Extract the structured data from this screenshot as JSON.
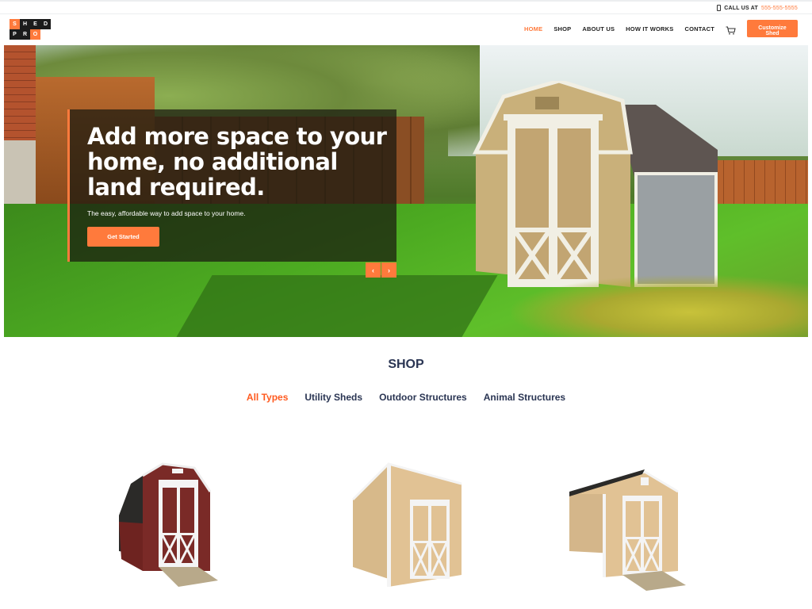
{
  "topbar": {
    "phone_icon": "phone-icon",
    "call_label": "CALL US AT",
    "phone_number": "555-555-5555"
  },
  "header": {
    "logo_letters": [
      "S",
      "H",
      "E",
      "D",
      "P",
      "R",
      "O"
    ],
    "nav": [
      {
        "label": "HOME",
        "active": true
      },
      {
        "label": "SHOP",
        "active": false
      },
      {
        "label": "ABOUT US",
        "active": false
      },
      {
        "label": "HOW IT WORKS",
        "active": false
      },
      {
        "label": "CONTACT",
        "active": false
      }
    ],
    "cart_icon": "cart-icon",
    "cta_label": "Customize Shed"
  },
  "hero": {
    "headline": "Add more space to your home, no additional land required.",
    "subtext": "The easy, affordable way to add space to your home.",
    "button_label": "Get Started",
    "prev_label": "‹",
    "next_label": "›"
  },
  "shop": {
    "title": "SHOP",
    "tabs": [
      {
        "label": "All Types",
        "active": true
      },
      {
        "label": "Utility Sheds",
        "active": false
      },
      {
        "label": "Outdoor Structures",
        "active": false
      },
      {
        "label": "Animal Structures",
        "active": false
      }
    ],
    "products": [
      {
        "name": "red-gambrel-shed"
      },
      {
        "name": "tan-lean-to-shed"
      },
      {
        "name": "tan-gable-shed"
      }
    ]
  },
  "colors": {
    "accent": "#ff7a3c",
    "tab_active": "#ff5a1f",
    "heading": "#2a3553"
  }
}
